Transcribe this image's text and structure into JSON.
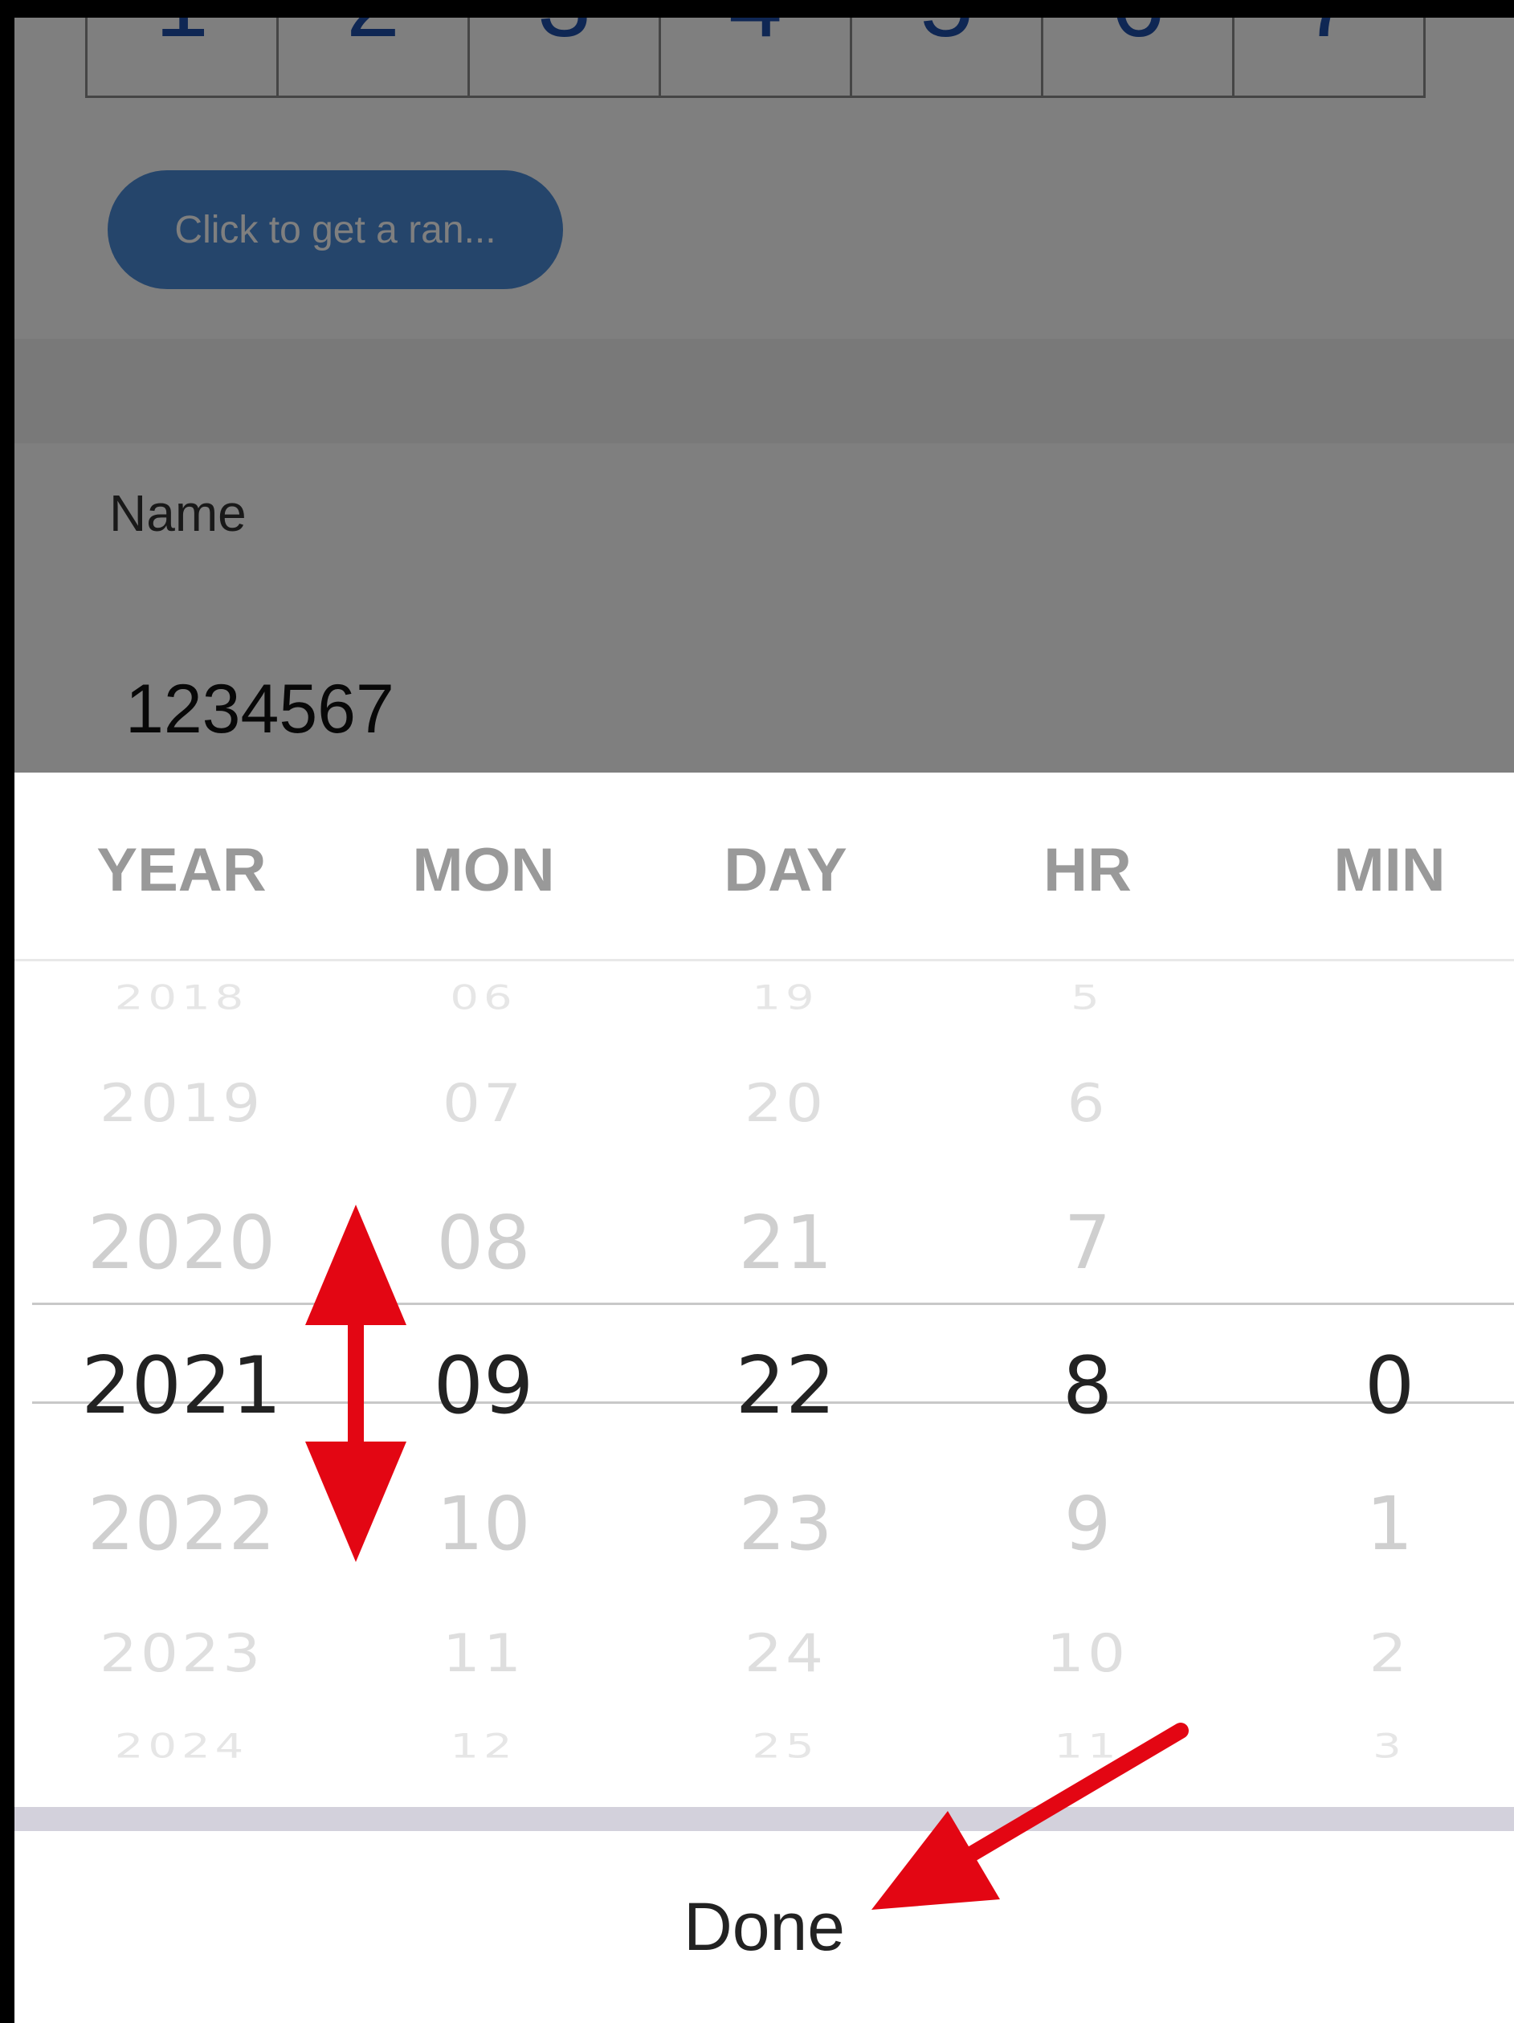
{
  "background_page": {
    "random_button_label": "Click to get a ran...",
    "name_label": "Name",
    "name_value": "1234567"
  },
  "picker": {
    "columns": [
      {
        "header": "YEAR",
        "values": [
          "2018",
          "2019",
          "2020",
          "2021",
          "2022",
          "2023",
          "2024"
        ]
      },
      {
        "header": "MON",
        "values": [
          "06",
          "07",
          "08",
          "09",
          "10",
          "11",
          "12"
        ]
      },
      {
        "header": "DAY",
        "values": [
          "19",
          "20",
          "21",
          "22",
          "23",
          "24",
          "25"
        ]
      },
      {
        "header": "HR",
        "values": [
          "5",
          "6",
          "7",
          "8",
          "9",
          "10",
          "11"
        ]
      },
      {
        "header": "MIN",
        "values": [
          "",
          "",
          "",
          "0",
          "1",
          "2",
          "3"
        ]
      }
    ],
    "selected_index": 3,
    "done_label": "Done"
  },
  "colors": {
    "annotation_arrow": "#e30613",
    "button_blue": "#4a8ad6",
    "digit_blue": "#1f4fa8"
  }
}
